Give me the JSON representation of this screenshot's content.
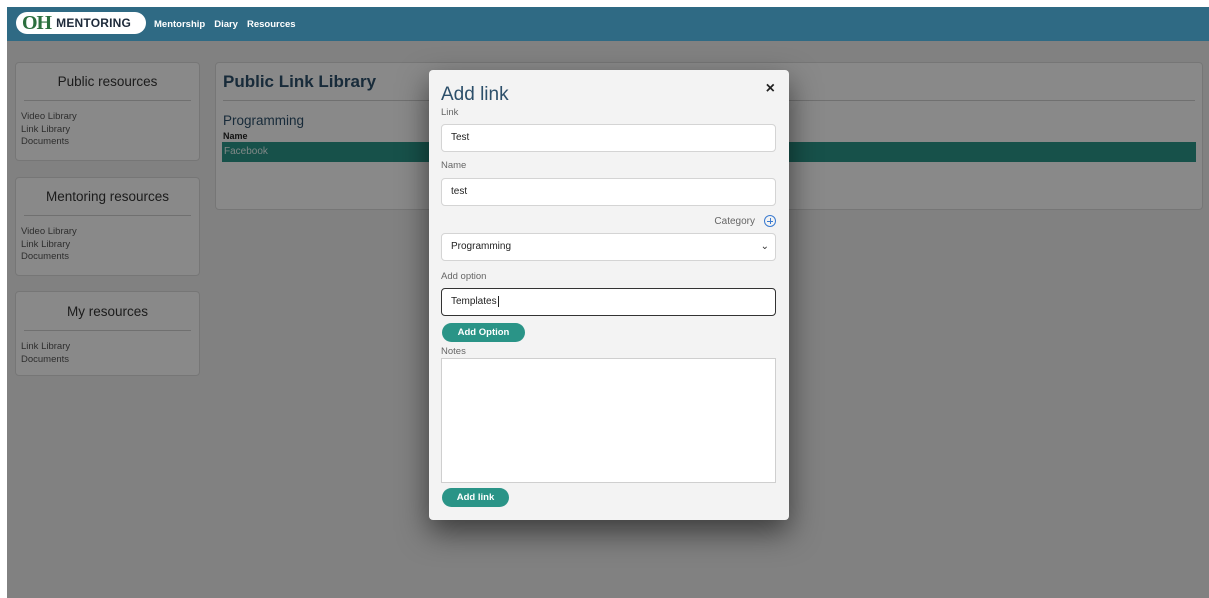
{
  "navbar": {
    "logo_mark": "OH",
    "logo_text": "MENTORING",
    "links": [
      "Mentorship",
      "Diary",
      "Resources"
    ]
  },
  "sidebar": {
    "sections": [
      {
        "title": "Public resources",
        "links": [
          "Video Library",
          "Link Library",
          "Documents"
        ]
      },
      {
        "title": "Mentoring resources",
        "links": [
          "Video Library",
          "Link Library",
          "Documents"
        ]
      },
      {
        "title": "My resources",
        "links": [
          "Link Library",
          "Documents"
        ]
      }
    ]
  },
  "main": {
    "title": "Public Link Library",
    "category": "Programming",
    "table_header": "Name",
    "rows": [
      "Facebook"
    ]
  },
  "modal": {
    "title": "Add link",
    "link_label": "Link",
    "link_value": "Test",
    "name_label": "Name",
    "name_value": "test",
    "category_label": "Category",
    "category_selected": "Programming",
    "add_option_label": "Add option",
    "add_option_value": "Templates",
    "add_option_button": "Add Option",
    "notes_label": "Notes",
    "notes_value": "",
    "submit_button": "Add link",
    "close_symbol": "×"
  },
  "colors": {
    "navbar": "#2f6a84",
    "accent": "#2a9487",
    "heading": "#2c4f6a"
  }
}
